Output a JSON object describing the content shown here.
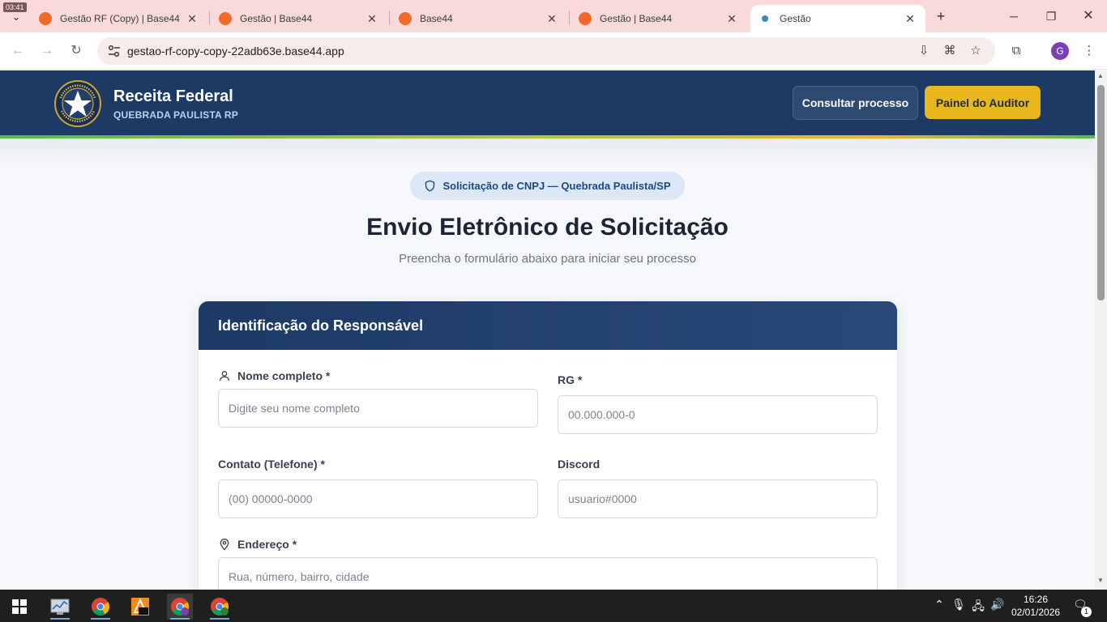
{
  "browser": {
    "overlay_time": "03:41",
    "tabs": [
      {
        "label": "Gestão RF (Copy) | Base44",
        "active": false
      },
      {
        "label": "Gestão | Base44",
        "active": false
      },
      {
        "label": "Base44",
        "active": false
      },
      {
        "label": "Gestão | Base44",
        "active": false
      },
      {
        "label": "Gestão",
        "active": true
      }
    ],
    "url": "gestao-rf-copy-copy-22adb63e.base44.app",
    "profile_initial": "G"
  },
  "header": {
    "brand_title": "Receita Federal",
    "brand_subtitle": "QUEBRADA PAULISTA RP",
    "logo_ring_text": "RECEITA FEDERAL · QUEBRADA PAULISTA",
    "consult_button": "Consultar processo",
    "auditor_button": "Painel do Auditor"
  },
  "hero": {
    "badge": "Solicitação de CNPJ — Quebrada Paulista/SP",
    "title": "Envio Eletrônico de Solicitação",
    "subtitle": "Preencha o formulário abaixo para iniciar seu processo"
  },
  "form": {
    "section_title": "Identificação do Responsável",
    "fields": {
      "nome": {
        "label": "Nome completo *",
        "placeholder": "Digite seu nome completo"
      },
      "rg": {
        "label": "RG *",
        "placeholder": "00.000.000-0"
      },
      "contato": {
        "label": "Contato (Telefone) *",
        "placeholder": "(00) 00000-0000"
      },
      "discord": {
        "label": "Discord",
        "placeholder": "usuario#0000"
      },
      "endereco": {
        "label": "Endereço *",
        "placeholder": "Rua, número, bairro, cidade"
      }
    }
  },
  "taskbar": {
    "time": "16:26",
    "date": "02/01/2026",
    "notification_count": "1"
  },
  "colors": {
    "header_bg": "#1c3a63",
    "accent_yellow": "#e8b61d",
    "badge_bg": "#dce8f7",
    "stripe_green": "#5cb84a"
  }
}
